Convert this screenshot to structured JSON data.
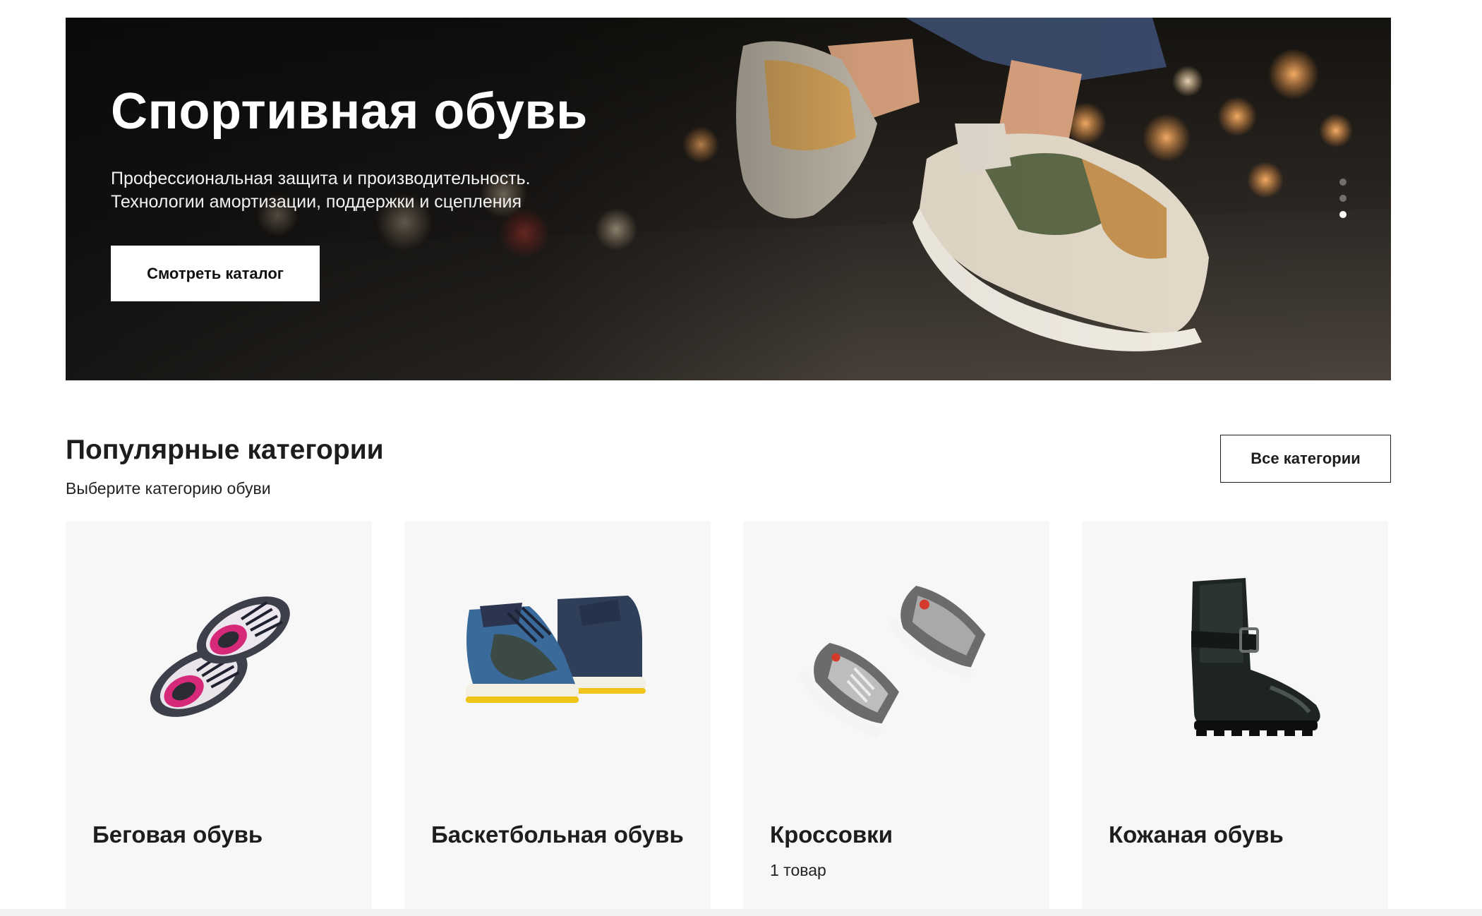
{
  "hero": {
    "title": "Спортивная обувь",
    "subtitle_line1": "Профессиональная защита и производительность.",
    "subtitle_line2": "Технологии амортизации, поддержки и сцепления",
    "cta_label": "Смотреть каталог",
    "slides_total": 3,
    "active_slide": 3,
    "image": "running-sneakers-night-street"
  },
  "categories_section": {
    "title": "Популярные категории",
    "subtitle": "Выберите категорию обуви",
    "all_button_label": "Все категории"
  },
  "categories": [
    {
      "name": "Беговая обувь",
      "count": "",
      "image": "pink-running-shoes"
    },
    {
      "name": "Баскетбольная обувь",
      "count": "",
      "image": "blue-high-top-sneakers"
    },
    {
      "name": "Кроссовки",
      "count": "1 товар",
      "image": "grey-sneakers"
    },
    {
      "name": "Кожаная обувь",
      "count": "",
      "image": "black-leather-boots"
    }
  ],
  "colors": {
    "hero_button_bg": "#ffffff",
    "card_bg": "#f7f7f7",
    "text_primary": "#1d1d1d"
  }
}
